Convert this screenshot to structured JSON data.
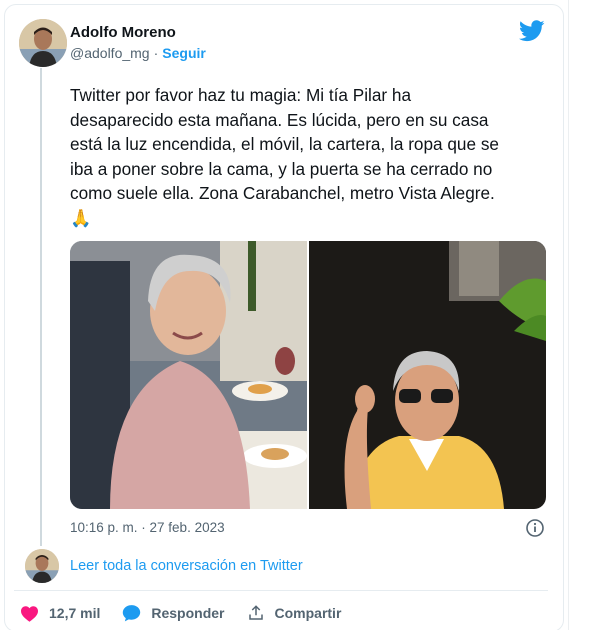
{
  "author": {
    "name": "Adolfo Moreno",
    "handle": "@adolfo_mg",
    "separator": "·",
    "follow_label": "Seguir"
  },
  "tweet": {
    "text": "Twitter por favor haz tu magia: Mi tía Pilar ha desaparecido esta mañana. Es lúcida, pero en su casa está la luz encendida, el móvil, la cartera, la ropa que se iba a poner sobre la cama, y la puerta se ha cerrado no como suele ella. Zona Carabanchel, metro Vista Alegre. 🙏",
    "timestamp": "10:16 p. m. · 27 feb. 2023"
  },
  "conversation_link": "Leer toda la conversación en Twitter",
  "actions": {
    "likes": "12,7 mil",
    "reply_label": "Responder",
    "share_label": "Compartir"
  },
  "colors": {
    "brand_blue": "#1d9bf0",
    "like_red": "#f91880",
    "text": "#0f1419",
    "muted": "#536471"
  },
  "icons": [
    "twitter-bird-icon",
    "info-icon",
    "heart-icon",
    "reply-bubble-icon",
    "share-icon"
  ]
}
